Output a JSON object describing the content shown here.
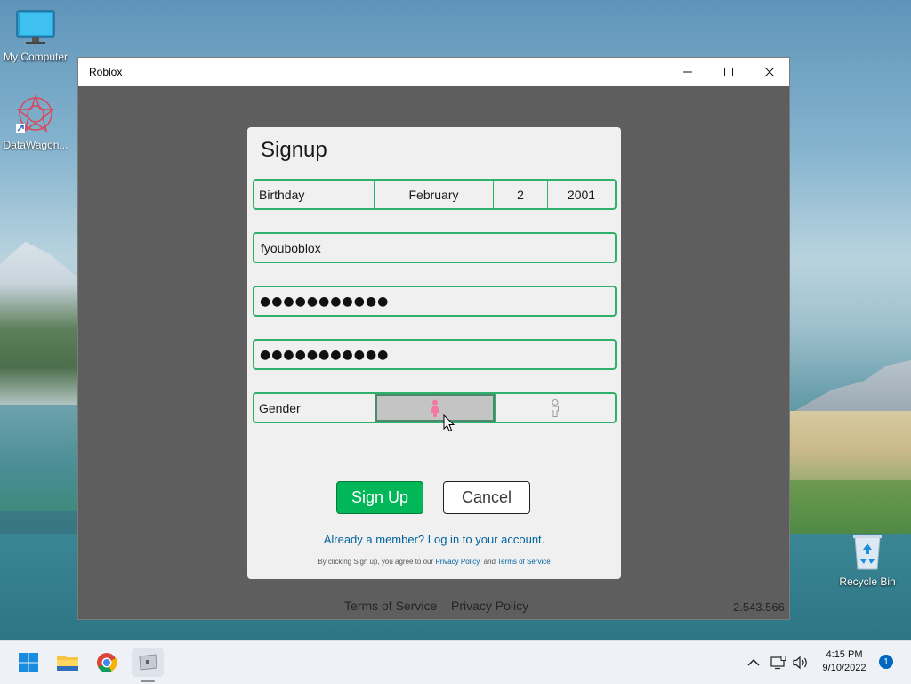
{
  "desktop": {
    "icons": [
      {
        "label": "My Computer"
      },
      {
        "label": "DataWagon..."
      },
      {
        "label": "Recycle Bin"
      }
    ]
  },
  "window": {
    "title": "Roblox",
    "controls": {
      "minimize": "—",
      "maximize": "☐",
      "close": "✕"
    }
  },
  "signup": {
    "title": "Signup",
    "birthday": {
      "label": "Birthday",
      "month": "February",
      "day": "2",
      "year": "2001"
    },
    "username_value": "fyouboblox",
    "password_value": "●●●●●●●●●●●",
    "confirm_password_value": "●●●●●●●●●●●",
    "gender": {
      "label": "Gender",
      "selected": "female"
    },
    "signup_button": "Sign Up",
    "cancel_button": "Cancel",
    "already_member": "Already a member? Log in to your account.",
    "legal_prefix": "By clicking Sign up, you agree to our",
    "legal_privacy": "Privacy Policy",
    "legal_and": "and",
    "legal_terms": "Terms of Service"
  },
  "footer": {
    "terms": "Terms of Service",
    "privacy": "Privacy Policy",
    "version": "2.543.566"
  },
  "taskbar": {
    "apps": [
      "start-icon",
      "file-explorer-icon",
      "chrome-icon",
      "roblox-icon"
    ],
    "time": "4:15 PM",
    "date": "9/10/2022",
    "notifications": "1"
  },
  "colors": {
    "accent_green": "#2fb06b",
    "signup_green": "#02b757",
    "link_blue": "#00639f",
    "selected_gender_bg": "#c4c4c4",
    "female_pink": "#f07aa0"
  }
}
